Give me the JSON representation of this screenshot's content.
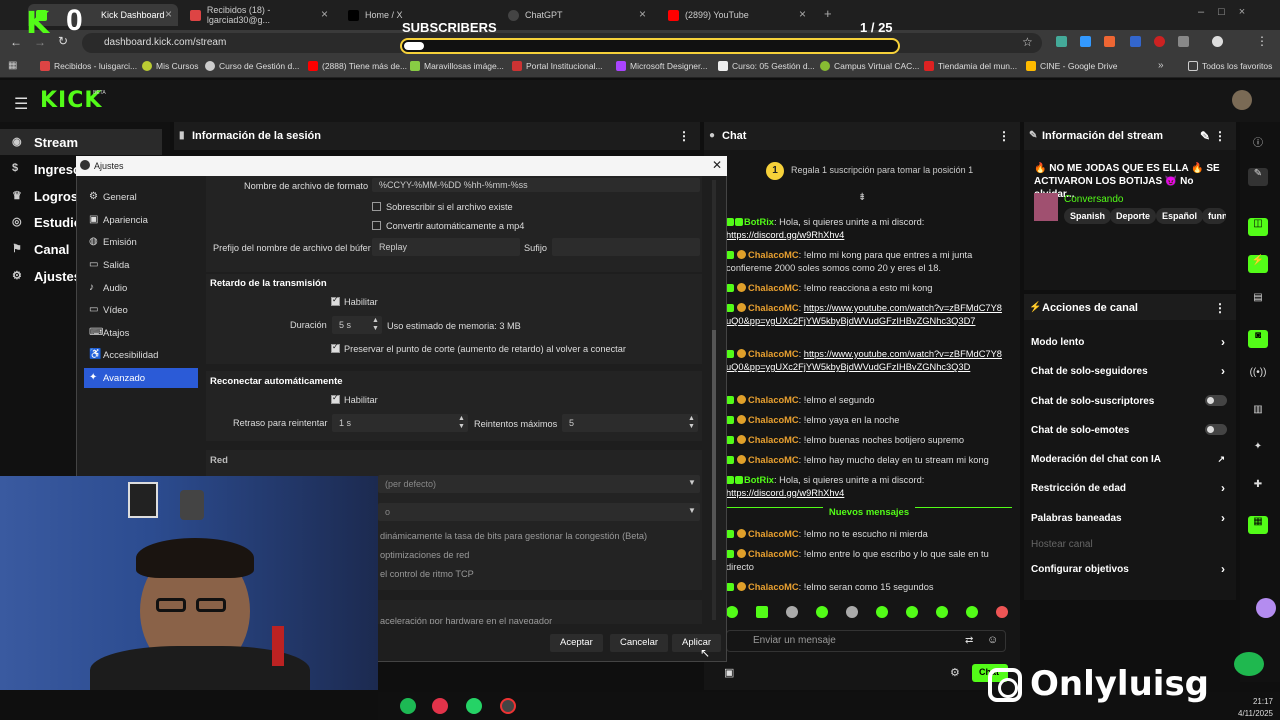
{
  "browser": {
    "tabs": [
      {
        "label": "Kick Dashboard"
      },
      {
        "label": "Recibidos (18) - lgarciad30@g..."
      },
      {
        "label": "Home / X"
      },
      {
        "label": "ChatGPT"
      },
      {
        "label": "(2899) YouTube"
      }
    ],
    "url": "dashboard.kick.com/stream",
    "bookmarks": [
      "Recibidos - luisgarci...",
      "Mis Cursos",
      "Curso de Gestión d...",
      "(2888) Tiene más de...",
      "Maravillosas imáge...",
      "Portal Institucional...",
      "Microsoft Designer...",
      "Curso: 05 Gestión d...",
      "Campus Virtual CAC...",
      "Tiendamia del mun...",
      "CINE - Google Drive"
    ],
    "all_favorites": "Todos los favoritos"
  },
  "overlay": {
    "subscribers_label": "SUBSCRIBERS",
    "count": "1 / 25",
    "progress": 0.04,
    "brand": "Onlyluisg",
    "big_zero": "0"
  },
  "kick": {
    "logo": "KICK",
    "beta": "BETA",
    "nav": [
      "Stream",
      "Ingresos",
      "Logros",
      "Estudio",
      "Canal",
      "Ajustes"
    ],
    "session_panel": "Información de la sesión",
    "chat_panel": "Chat",
    "stream_panel": "Información del stream",
    "actions_panel": "Acciones de canal"
  },
  "chat": {
    "gift_count": "1",
    "gift_text": "Regala 1 suscripción para tomar la posición 1",
    "messages": [
      {
        "user": "BotRix",
        "text": "Hola, si quieres unirte a mi discord: ",
        "link": "https://discord.gg/w9RhXhv4"
      },
      {
        "user": "ChalacoMC",
        "text": "!elmo mi kong para que entres a mi junta confiereme 2000 soles somos como 20 y eres el 18."
      },
      {
        "user": "ChalacoMC",
        "text": "!elmo reacciona a esto mi kong"
      },
      {
        "user": "ChalacoMC",
        "link": "https://www.youtube.com/watch?v=zBFMdC7Y8uQ0&pp=ygUXc2FjYW5kbyBjdWVudGFzIHBvZGNhc3Q3D7"
      },
      {
        "user": "ChalacoMC",
        "link": "https://www.youtube.com/watch?v=zBFMdC7Y8uQ0&pp=ygUXc2FjYW5kbyBjdWVudGFzIHBvZGNhc3Q3D"
      },
      {
        "user": "ChalacoMC",
        "text": "!elmo el segundo"
      },
      {
        "user": "ChalacoMC",
        "text": "!elmo yaya en la noche"
      },
      {
        "user": "ChalacoMC",
        "text": "!elmo buenas noches botijero supremo"
      },
      {
        "user": "ChalacoMC",
        "text": "!elmo hay mucho delay en tu stream mi kong"
      },
      {
        "user": "BotRix",
        "text": "Hola, si quieres unirte a mi discord: ",
        "link": "https://discord.gg/w9RhXhv4"
      },
      {
        "user": "ChalacoMC",
        "text": "!elmo no te escucho ni mierda"
      },
      {
        "user": "ChalacoMC",
        "text": "!elmo entre lo que escribo y lo que sale en tu directo"
      },
      {
        "user": "ChalacoMC",
        "text": "!elmo seran como 15 segundos"
      }
    ],
    "new_messages": "Nuevos mensajes",
    "input_placeholder": "Enviar un mensaje",
    "send_label": "Chat"
  },
  "stream_info": {
    "title": "🔥 NO ME JODAS QUE ES ELLA 🔥 SE ACTIVARON LOS BOTIJAS 😈 No olvidar...",
    "category": "Conversando",
    "tags": [
      "Spanish",
      "Deporte",
      "Español",
      "funn"
    ]
  },
  "actions": [
    {
      "label": "Modo lento",
      "kind": "chevron"
    },
    {
      "label": "Chat de solo-seguidores",
      "kind": "chevron"
    },
    {
      "label": "Chat de solo-suscriptores",
      "kind": "toggle"
    },
    {
      "label": "Chat de solo-emotes",
      "kind": "toggle"
    },
    {
      "label": "Moderación del chat con IA",
      "kind": "external"
    },
    {
      "label": "Restricción de edad",
      "kind": "chevron"
    },
    {
      "label": "Palabras baneadas",
      "kind": "chevron"
    },
    {
      "label": "Hostear canal",
      "kind": "disabled"
    },
    {
      "label": "Configurar objetivos",
      "kind": "chevron"
    }
  ],
  "settings": {
    "title": "Ajustes",
    "sidebar": [
      "General",
      "Apariencia",
      "Emisión",
      "Salida",
      "Audio",
      "Vídeo",
      "Atajos",
      "Accesibilidad",
      "Avanzado"
    ],
    "format_label": "Nombre de archivo de formato",
    "format_value": "%CCYY-%MM-%DD %hh-%mm-%ss",
    "overwrite": "Sobrescribir si el archivo existe",
    "remux": "Convertir automáticamente a mp4",
    "buffer_prefix_label": "Prefijo del nombre de archivo del búfer",
    "buffer_prefix": "Replay",
    "suffix_label": "Sufijo",
    "delay_section": "Retardo de la transmisión",
    "enable": "Habilitar",
    "duration_label": "Duración",
    "duration_value": "5 s",
    "memory_usage": "Uso estimado de memoria: 3 MB",
    "preserve": "Preservar el punto de corte (aumento de retardo) al volver a conectar",
    "reconnect_section": "Reconectar automáticamente",
    "retry_delay_label": "Retraso para reintentar",
    "retry_delay": "1 s",
    "max_retries_label": "Reintentos máximos",
    "max_retries": "5",
    "network_section": "Red",
    "bind_ip": "(per defecto)",
    "dynamic_bitrate": "dinámicamente la tasa de bits para gestionar la congestión (Beta)",
    "network_opt": "optimizaciones de red",
    "tcp_pacing": "el control de ritmo TCP",
    "hw_accel": "aceleración por hardware en el navegador",
    "btn_ok": "Aceptar",
    "btn_cancel": "Cancelar",
    "btn_apply": "Aplicar"
  },
  "clock": {
    "time": "21:17",
    "date": "4/11/2025"
  },
  "colors": {
    "kick_green": "#53fc18",
    "accent_blue": "#2b5bd7",
    "sub_bar": "#f6d13a",
    "username": "#e8a030"
  }
}
